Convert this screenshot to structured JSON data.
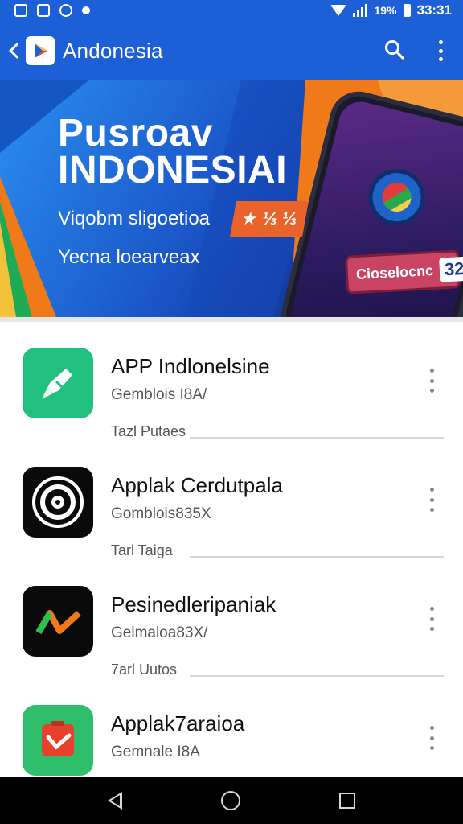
{
  "status_bar": {
    "battery_text": "19%",
    "time": "33:31",
    "icons": [
      "notification-icon",
      "photo-icon",
      "globe-icon",
      "dot-icon",
      "wifi-icon",
      "signal-icon",
      "battery-icon"
    ]
  },
  "app_bar": {
    "title": "Andonesia",
    "icons": [
      "back-icon",
      "play-store-logo",
      "search-icon",
      "more-vert-icon"
    ]
  },
  "banner": {
    "title_line1": "Pusroav",
    "title_line2": "INDONESIAI",
    "subtitle_line1": "Viqobm sligoetioa",
    "subtitle_line2": "Yecna loearveax",
    "badge_text": "★ ⅓ ⅓",
    "phone_tag_text": "Cioselocnc",
    "phone_tag_number": "32"
  },
  "apps": [
    {
      "name": "APP Indlonelsine",
      "developer": "Gemblois I8A/",
      "meta": "Tazl Putaes",
      "icon_color": "#22c07e",
      "icon": "pen-icon"
    },
    {
      "name": "Applak Cerdutpala",
      "developer": "Gomblois835X",
      "meta": "Tarl Taiga",
      "icon_color": "#0a0a0a",
      "icon": "vinyl-icon"
    },
    {
      "name": "Pesinedleripaniak",
      "developer": "Gelmaloa83X/",
      "meta": "7arl Uutos",
      "icon_color": "#0a0a0a",
      "icon": "chart-check-icon"
    },
    {
      "name": "Applak7araioa",
      "developer": "Gemnale I8A",
      "meta": "",
      "icon_color": "#2fbe6b",
      "icon": "phone-card-icon"
    }
  ],
  "nav_bar": {
    "icons": [
      "nav-back-icon",
      "nav-home-icon",
      "nav-recents-icon"
    ]
  },
  "colors": {
    "primary": "#1d5fd6",
    "accent_orange": "#f07a1a"
  }
}
